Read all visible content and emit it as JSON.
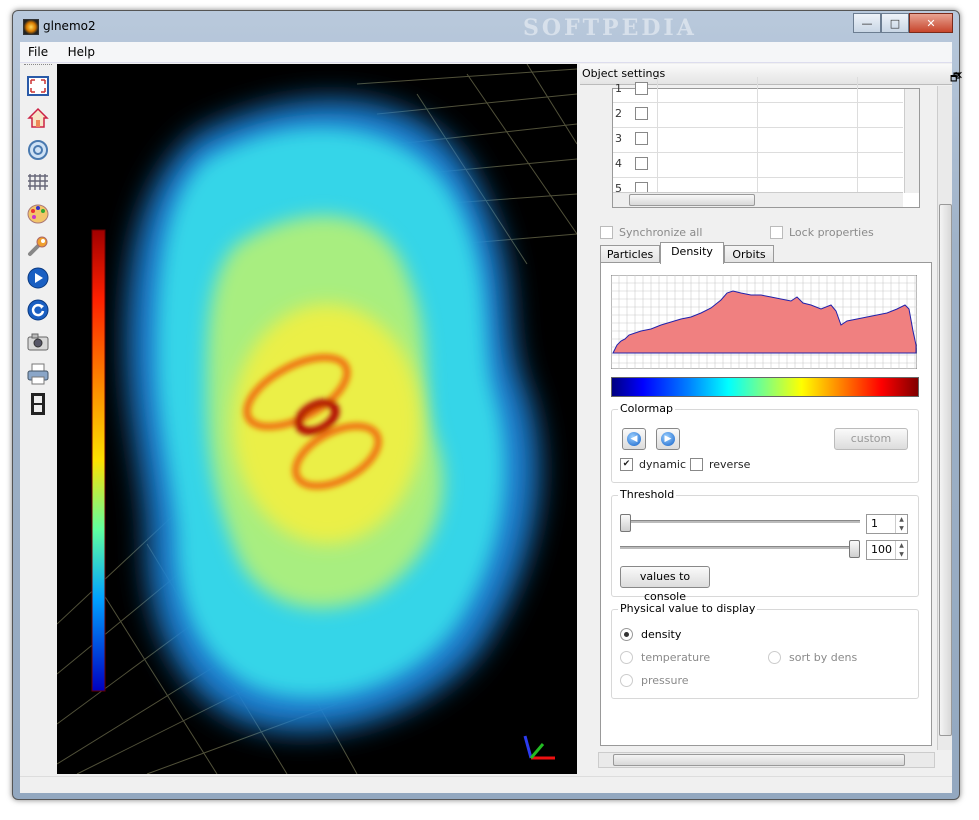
{
  "window": {
    "title": "glnemo2",
    "watermark": "SOFTPEDIA",
    "controls": {
      "minimize": "—",
      "maximize": "□",
      "close": "✕"
    }
  },
  "menu": [
    {
      "label": "File"
    },
    {
      "label": "Help"
    }
  ],
  "toolbar": [
    {
      "name": "fullscreen-icon"
    },
    {
      "name": "home-icon"
    },
    {
      "name": "zoom-icon"
    },
    {
      "name": "grid-icon"
    },
    {
      "name": "palette-icon"
    },
    {
      "name": "wrench-icon"
    },
    {
      "name": "play-icon"
    },
    {
      "name": "reload-icon"
    },
    {
      "name": "camera-icon"
    },
    {
      "name": "printer-icon"
    },
    {
      "name": "film-icon"
    }
  ],
  "panel": {
    "title": "Object settings",
    "float_icon": "🗗",
    "close_icon": "✕",
    "table_rows": [
      "1",
      "2",
      "3",
      "4",
      "5"
    ],
    "synchronize_label": "Synchronize all",
    "lock_label": "Lock properties",
    "tabs": [
      "Particles",
      "Density",
      "Orbits"
    ],
    "active_tab": "Density",
    "colormap": {
      "title": "Colormap",
      "custom_label": "custom",
      "dynamic_label": "dynamic",
      "dynamic_checked": true,
      "reverse_label": "reverse",
      "reverse_checked": false
    },
    "threshold": {
      "title": "Threshold",
      "min_value": "1",
      "max_value": "100",
      "console_button": "values to console"
    },
    "physical": {
      "title": "Physical value to display",
      "options": [
        "density",
        "temperature",
        "sort by dens",
        "pressure"
      ],
      "selected": "density"
    }
  },
  "colors": {
    "histogram_fill": "#f08080",
    "histogram_line": "#2222aa"
  }
}
